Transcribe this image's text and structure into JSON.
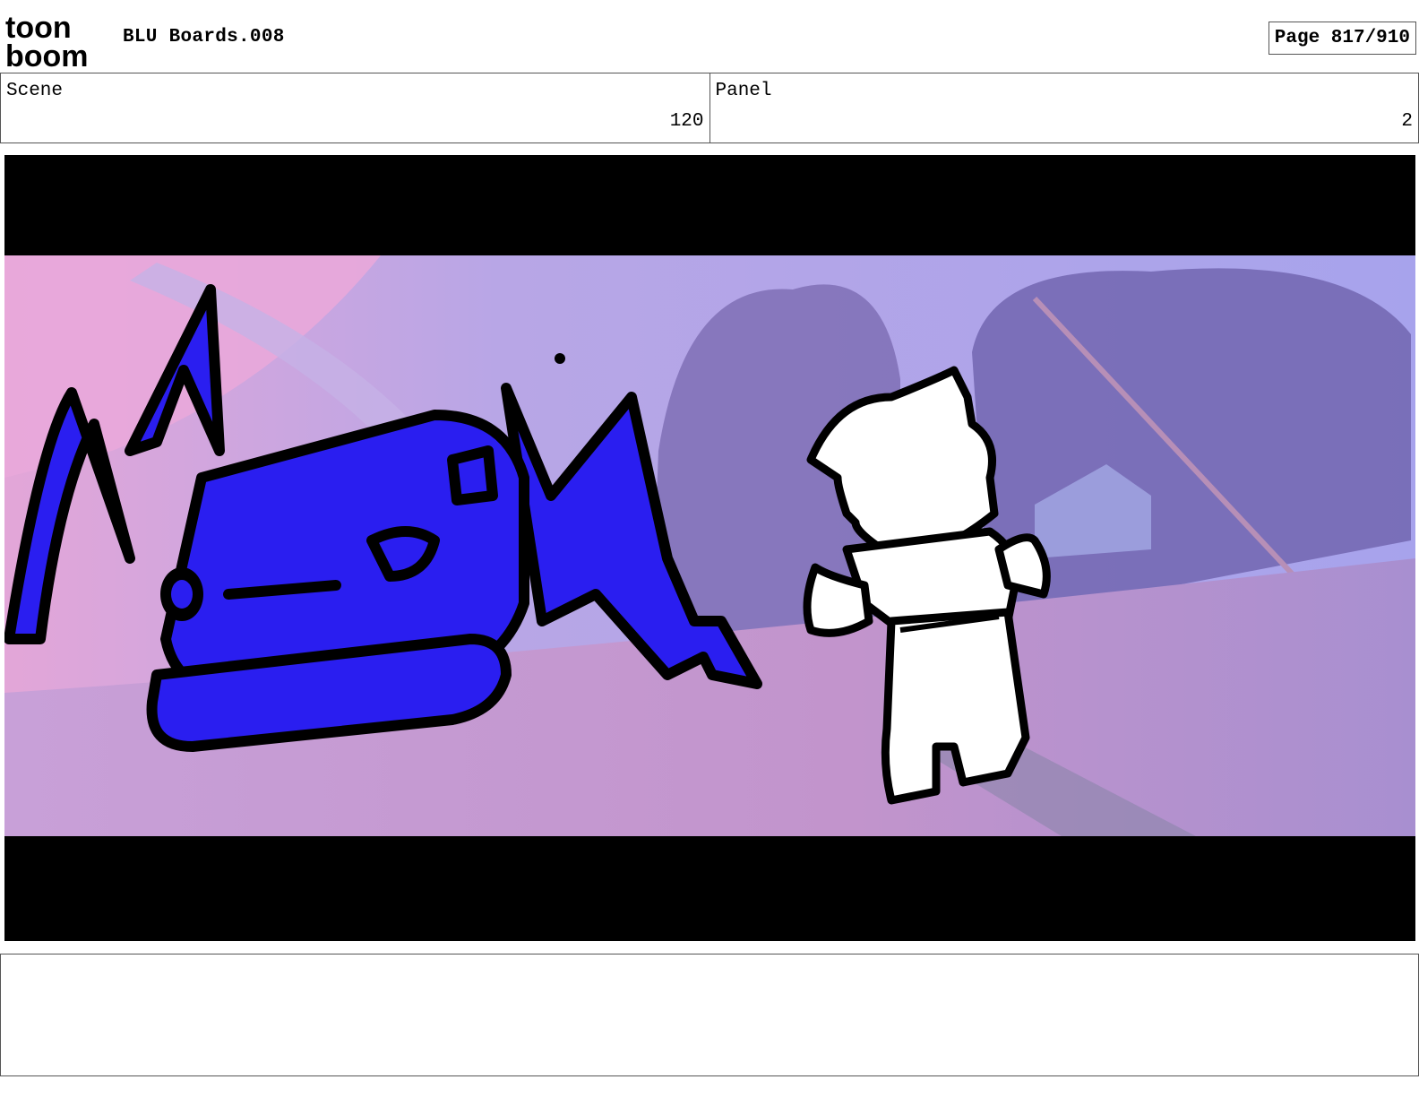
{
  "header": {
    "logo_text_top": "toon",
    "logo_text_bottom": "boom",
    "title": "BLU Boards.008",
    "page_label": "Page 817/910"
  },
  "scene": {
    "label": "Scene",
    "value": "120"
  },
  "panel": {
    "label": "Panel",
    "value": "2"
  },
  "colors": {
    "sky": "#a8a6ee",
    "ground": "#c898cc",
    "robot_blue": "#2a1ef0",
    "letterbox": "#000000"
  },
  "notes": {
    "text": ""
  }
}
